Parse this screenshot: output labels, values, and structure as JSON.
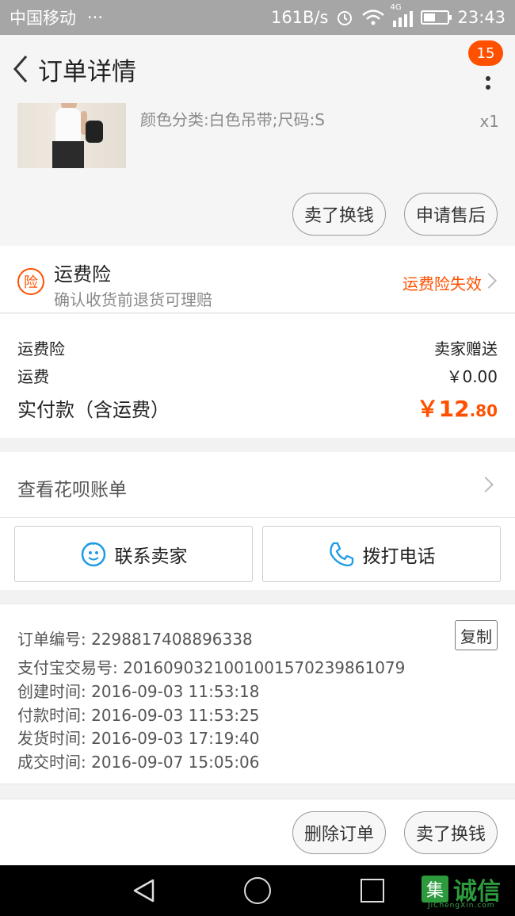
{
  "status_bar": {
    "carrier": "中国移动",
    "dots": "···",
    "net_speed": "161B/s",
    "network": "4G",
    "time": "23:43"
  },
  "header": {
    "title": "订单详情",
    "badge_count": "15"
  },
  "product": {
    "sku": "颜色分类:白色吊带;尺码:S",
    "quantity": "x1",
    "sell_button": "卖了换钱",
    "after_sale_button": "申请售后"
  },
  "insurance": {
    "icon_char": "险",
    "title": "运费险",
    "subtitle": "确认收货前退货可理赔",
    "status": "运费险失效"
  },
  "costs": {
    "insurance_label": "运费险",
    "insurance_value": "卖家赠送",
    "shipping_label": "运费",
    "shipping_value": "￥0.00",
    "total_label": "实付款（含运费）",
    "total_currency": "￥",
    "total_int": "12",
    "total_dec": ".80"
  },
  "huabei": {
    "label": "查看花呗账单"
  },
  "contact": {
    "seller_button": "联系卖家",
    "call_button": "拨打电话"
  },
  "order_info": {
    "order_no": "订单编号: 2298817408896338",
    "alipay_no": "支付宝交易号: 2016090321001001570239861079",
    "created": "创建时间: 2016-09-03 11:53:18",
    "paid": "付款时间: 2016-09-03 11:53:25",
    "shipped": "发货时间: 2016-09-03 17:19:40",
    "completed": "成交时间: 2016-09-07 15:05:06",
    "copy_button": "复制"
  },
  "actions": {
    "delete_button": "删除订单",
    "sell_button": "卖了换钱"
  },
  "watermark": {
    "logo_char": "集",
    "text": "诚信",
    "sub": "JiChengXin.com"
  },
  "colors": {
    "accent": "#ff5000",
    "contact_icon": "#1e9be5",
    "watermark": "#2d9a3e"
  }
}
